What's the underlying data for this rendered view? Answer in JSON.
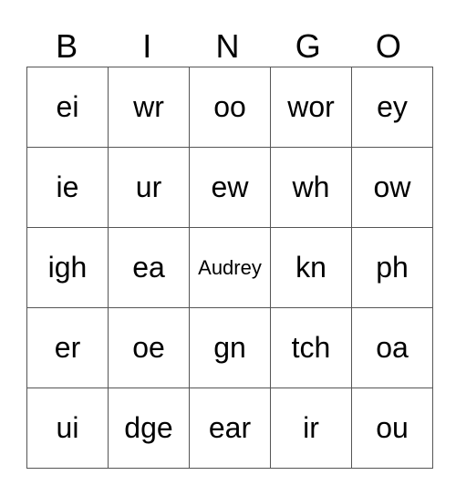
{
  "header": [
    "B",
    "I",
    "N",
    "G",
    "O"
  ],
  "rows": [
    [
      "ei",
      "wr",
      "oo",
      "wor",
      "ey"
    ],
    [
      "ie",
      "ur",
      "ew",
      "wh",
      "ow"
    ],
    [
      "igh",
      "ea",
      "Audrey",
      "kn",
      "ph"
    ],
    [
      "er",
      "oe",
      "gn",
      "tch",
      "oa"
    ],
    [
      "ui",
      "dge",
      "ear",
      "ir",
      "ou"
    ]
  ]
}
